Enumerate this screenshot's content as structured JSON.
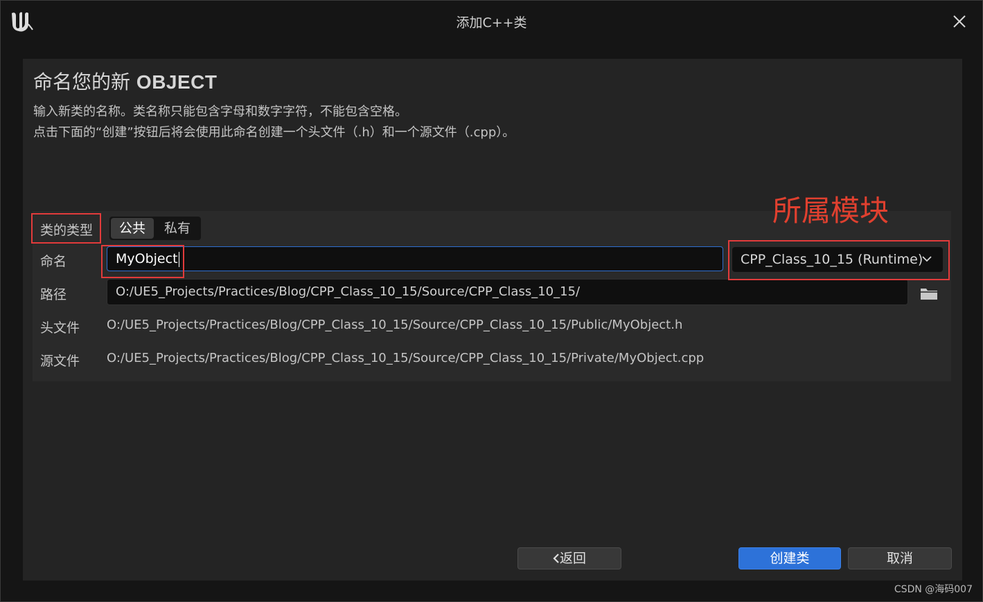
{
  "window": {
    "title": "添加C++类"
  },
  "header": {
    "heading_prefix": "命名您的新",
    "heading_class": "OBJECT",
    "desc_line1": "输入新类的名称。类名称只能包含字母和数字字符，不能包含空格。",
    "desc_line2": "点击下面的“创建”按钮后将会使用此命名创建一个头文件（.h）和一个源文件（.cpp）。"
  },
  "form": {
    "class_type_label": "类的类型",
    "class_type_options": [
      "公共",
      "私有"
    ],
    "class_type_selected": "公共",
    "name_label": "命名",
    "name_value": "MyObject",
    "module_value": "CPP_Class_10_15 (Runtime)",
    "path_label": "路径",
    "path_value": "O:/UE5_Projects/Practices/Blog/CPP_Class_10_15/Source/CPP_Class_10_15/",
    "header_label": "头文件",
    "header_value": "O:/UE5_Projects/Practices/Blog/CPP_Class_10_15/Source/CPP_Class_10_15/Public/MyObject.h",
    "source_label": "源文件",
    "source_value": "O:/UE5_Projects/Practices/Blog/CPP_Class_10_15/Source/CPP_Class_10_15/Private/MyObject.cpp"
  },
  "annotation": {
    "module_note": "所属模块",
    "color": "#e23b3b"
  },
  "footer": {
    "back_label": "返回",
    "create_label": "创建类",
    "cancel_label": "取消"
  },
  "watermark": "CSDN @海码007",
  "colors": {
    "accent": "#2d72d9",
    "background": "#151515",
    "panel": "#242424"
  },
  "icons": [
    "unreal-logo-icon",
    "close-icon",
    "chevron-down-icon",
    "folder-icon",
    "chevron-left-icon"
  ]
}
